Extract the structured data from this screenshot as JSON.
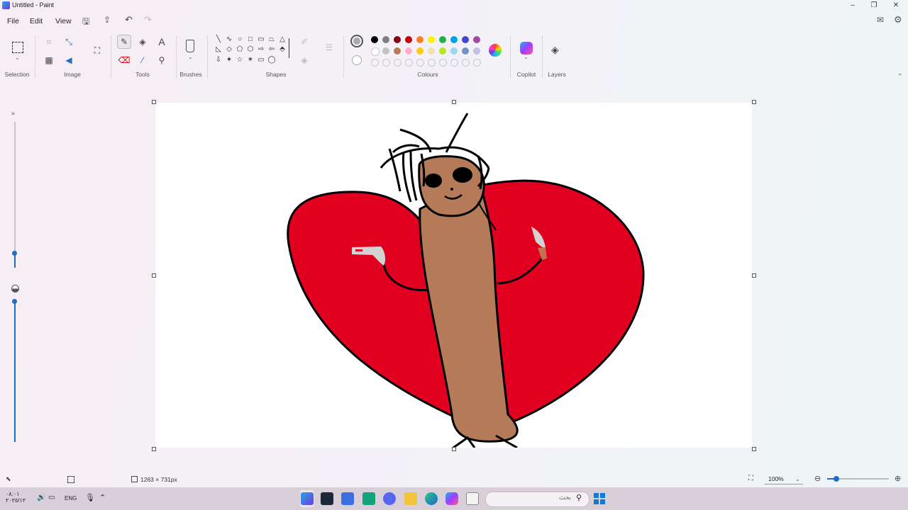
{
  "window": {
    "title": "Untitled - Paint",
    "controls": {
      "minimize": "–",
      "maximize": "❐",
      "close": "✕"
    }
  },
  "menu": [
    "File",
    "Edit",
    "View"
  ],
  "ribbon": {
    "groups": {
      "selection": "Selection",
      "image": "Image",
      "tools": "Tools",
      "brushes": "Brushes",
      "shapes": "Shapes",
      "colours": "Colours",
      "copilot": "Copilot",
      "layers": "Layers"
    },
    "tool_icons": {
      "pencil": "✎",
      "fill": "◈",
      "text": "A",
      "eraser": "⌫",
      "picker": "⁄",
      "magnifier": "⚲"
    },
    "shapes_row1": [
      "╲",
      "∿",
      "○",
      "□",
      "▭",
      "⏢",
      "△"
    ],
    "shapes_row2": [
      "◺",
      "◇",
      "⬠",
      "⬡",
      "⇨",
      "⇦",
      "⬘"
    ],
    "shapes_row3": [
      "⇩",
      "✦",
      "☆",
      "✶",
      "▭",
      "◯",
      ""
    ],
    "colours_row1": [
      "#000000",
      "#7f7f7f",
      "#880015",
      "#c3000f",
      "#ff7f27",
      "#fff200",
      "#22b14c",
      "#00a2e8",
      "#3f48cc",
      "#a349a4"
    ],
    "colours_row2": [
      "#ffffff",
      "#c3c3c3",
      "#b97a57",
      "#ffaec9",
      "#ffc90e",
      "#efe4b0",
      "#b5e61d",
      "#99d9ea",
      "#7092be",
      "#c8bfe7"
    ],
    "primary_colour": "#a9a9a9"
  },
  "status": {
    "canvas_size": "1263 × 731px",
    "zoom": "100%"
  },
  "taskbar": {
    "time": "٠٨:٠١",
    "date": "٢٠٢٥/١٢",
    "language": "ENG",
    "search_placeholder": "بحث",
    "icons": [
      "paint-icon",
      "steam-icon",
      "app-icon",
      "controller-icon",
      "discord-icon",
      "explorer-icon",
      "edge-icon",
      "copilot-icon",
      "files-icon",
      "windows-icon"
    ]
  }
}
